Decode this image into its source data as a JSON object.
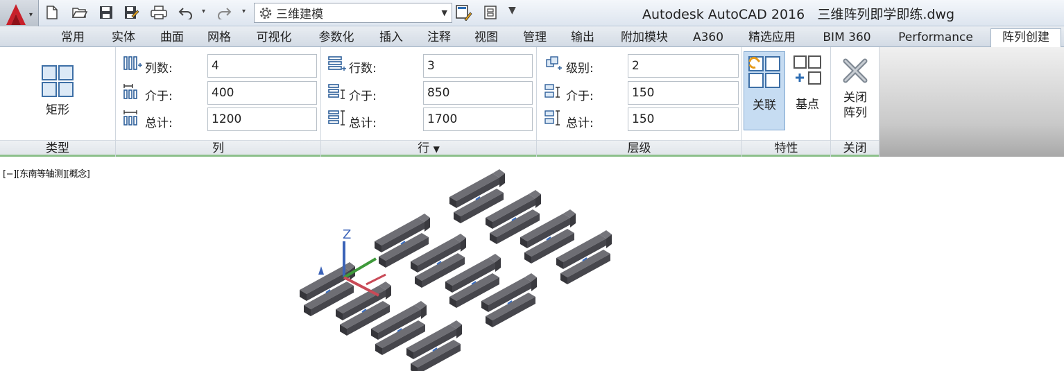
{
  "app": {
    "title": "Autodesk AutoCAD 2016",
    "file": "三维阵列即学即练.dwg"
  },
  "quick_access": {
    "workspace": "三维建模"
  },
  "tabs": [
    "常用",
    "实体",
    "曲面",
    "网格",
    "可视化",
    "参数化",
    "插入",
    "注释",
    "视图",
    "管理",
    "输出",
    "附加模块",
    "A360",
    "精选应用",
    "BIM 360",
    "Performance",
    "阵列创建"
  ],
  "active_tab": "阵列创建",
  "ribbon": {
    "type_panel": {
      "title": "类型",
      "button": "矩形"
    },
    "columns_panel": {
      "title": "列",
      "count_label": "列数:",
      "count_value": "4",
      "spacing_label": "介于:",
      "spacing_value": "400",
      "total_label": "总计:",
      "total_value": "1200"
    },
    "rows_panel": {
      "title": "行",
      "count_label": "行数:",
      "count_value": "3",
      "spacing_label": "介于:",
      "spacing_value": "850",
      "total_label": "总计:",
      "total_value": "1700"
    },
    "levels_panel": {
      "title": "层级",
      "count_label": "级别:",
      "count_value": "2",
      "spacing_label": "介于:",
      "spacing_value": "150",
      "total_label": "总计:",
      "total_value": "150"
    },
    "props_panel": {
      "title": "特性",
      "associative": "关联",
      "basepoint": "基点"
    },
    "close_panel": {
      "title": "关闭",
      "close_line1": "关闭",
      "close_line2": "阵列"
    }
  },
  "viewport": {
    "label": "[−][东南等轴测][概念]",
    "ucs_z": "Z"
  },
  "colors": {
    "accent_green": "#8cc08a",
    "active_blue": "#c6dcf2",
    "object_gray": "#4a4a4e"
  }
}
